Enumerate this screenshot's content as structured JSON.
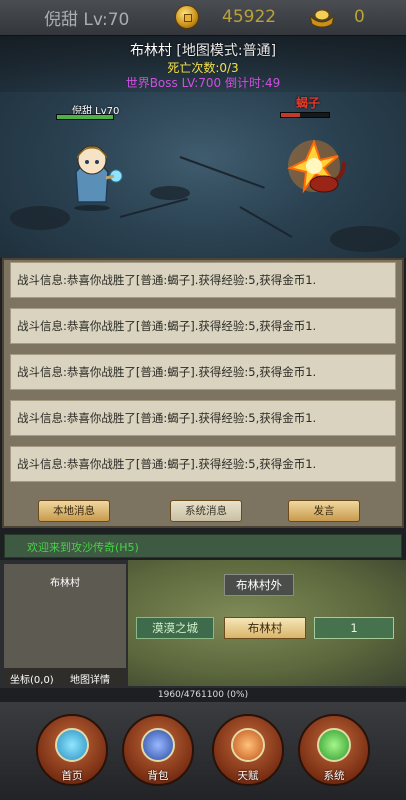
{
  "topbar": {
    "player": "倪甜 Lv:70",
    "gold": "45922",
    "ingots": "0"
  },
  "scene": {
    "map_name": "布林村",
    "map_mode": "[地图模式:普通]",
    "deaths": "死亡次数:0/3",
    "boss_timer": "世界Boss LV:700 倒计时:49",
    "hero_name": "倪甜 Lv70",
    "enemy_name": "蝎子"
  },
  "messages": {
    "rows": [
      "战斗信息:恭喜你战胜了[普通:蝎子].获得经验:5,获得金币1.",
      "战斗信息:恭喜你战胜了[普通:蝎子].获得经验:5,获得金币1.",
      "战斗信息:恭喜你战胜了[普通:蝎子].获得经验:5,获得金币1.",
      "战斗信息:恭喜你战胜了[普通:蝎子].获得经验:5,获得金币1.",
      "战斗信息:恭喜你战胜了[普通:蝎子].获得经验:5,获得金币1."
    ],
    "tab_local": "本地消息",
    "tab_system": "系统消息",
    "tab_speak": "发言"
  },
  "announce": "欢迎来到攻沙传奇(H5)",
  "map": {
    "minimap_title": "布林村",
    "coords": "坐标(0,0)",
    "details": "地图详情",
    "outer_village": "布林村外",
    "desert_city": "漠漠之城",
    "current": "布林村",
    "field": "1"
  },
  "exp_progress": "1960/4761100 (0%)",
  "nav": {
    "home": "首页",
    "bag": "背包",
    "talent": "天赋",
    "system": "系统"
  }
}
